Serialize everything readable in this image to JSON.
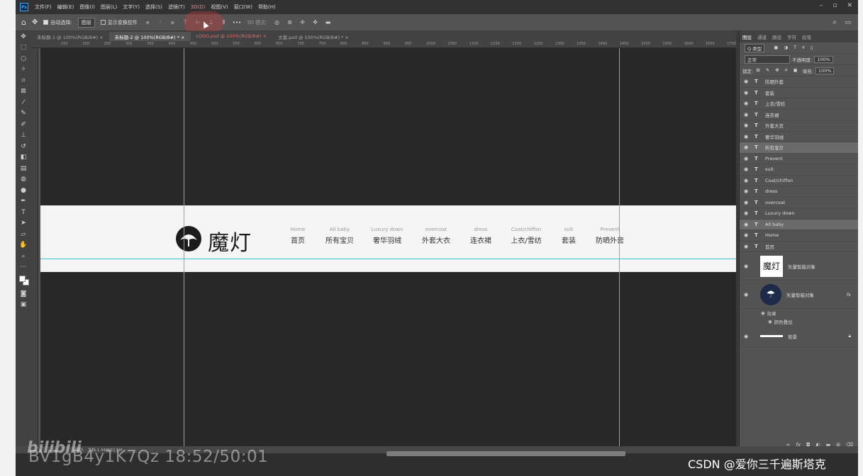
{
  "menubar": {
    "logo": "Ps",
    "items": [
      "文件(F)",
      "编辑(E)",
      "图像(I)",
      "图层(L)",
      "文字(Y)",
      "选择(S)",
      "滤镜(T)",
      "3D(D)",
      "视图(V)",
      "窗口(W)",
      "帮助(H)"
    ],
    "window_controls": [
      "–",
      "▫",
      "✕"
    ]
  },
  "options": {
    "auto_select_label": "自动选择:",
    "auto_select_value": "图层",
    "show_transform_label": "显示变换控件",
    "more": "•••",
    "mode_3d": "3D 模式:"
  },
  "tabs": [
    {
      "label": "未标题-1 @ 100%(RGB/8#)",
      "close": "×"
    },
    {
      "label": "未标题-2 @ 100%(RGB/8#) *",
      "close": "×"
    },
    {
      "label": "LOGO.psd @ 100%(RGB/8#)",
      "close": "×"
    },
    {
      "label": "文案.psd @ 100%(RGB/8#) *",
      "close": "×"
    }
  ],
  "ruler_ticks": [
    "150",
    "200",
    "250",
    "300",
    "350",
    "400",
    "450",
    "500",
    "550",
    "600",
    "650",
    "700",
    "750",
    "800",
    "850",
    "900",
    "950",
    "1000",
    "1050",
    "1100",
    "1150",
    "1200",
    "1250",
    "1300",
    "1350",
    "1400",
    "1450",
    "1500",
    "1550",
    "1600",
    "1650",
    "1700"
  ],
  "banner": {
    "logo_text": "魔灯",
    "nav": [
      {
        "en": "Home",
        "cn": "首页"
      },
      {
        "en": "All baby",
        "cn": "所有宝贝"
      },
      {
        "en": "Luxury down",
        "cn": "奢华羽绒"
      },
      {
        "en": "overcoat",
        "cn": "外套大衣"
      },
      {
        "en": "dress",
        "cn": "连衣裙"
      },
      {
        "en": "Coat/chiffon",
        "cn": "上衣/雪纺"
      },
      {
        "en": "suit",
        "cn": "套装"
      },
      {
        "en": "Prevent",
        "cn": "防晒外套"
      }
    ]
  },
  "panel": {
    "tabs": [
      "图层",
      "通道",
      "路径",
      "字符",
      "段落"
    ],
    "filter_label": "Q 类型",
    "blend_mode": "正常",
    "opacity_label": "不透明度:",
    "opacity_value": "100%",
    "lock_label": "锁定:",
    "fill_label": "填充:",
    "fill_value": "100%",
    "text_layers": [
      "防晒外套",
      "套装",
      "上衣/雪纺",
      "连衣裙",
      "外套大衣",
      "奢华羽绒",
      "所有宝贝",
      "Prevent",
      "suit",
      "Coat/chiffon",
      "dress",
      "overcoat",
      "Luxury down",
      "All baby",
      "Home",
      "首页"
    ],
    "selected_layers": [
      "所有宝贝",
      "All baby"
    ],
    "smart_object_1": "矢量智能对象",
    "smart_object_2": "矢量智能对象",
    "fx": "fx",
    "effects_label": "效果",
    "color_overlay_label": "颜色叠加",
    "background_label": "背景",
    "footer_icons": [
      "link-icon",
      "fx-icon",
      "mask-icon",
      "adjustment-icon",
      "folder-icon",
      "new-layer-icon",
      "trash-icon"
    ]
  },
  "status": {
    "zoom": "100%",
    "doc": "文档:1.34M/22.5M"
  },
  "overlay": {
    "watermark_brand": "bilibili",
    "video_id": "BV1gB4y1K7Qz 18:52/50:01",
    "csdn": "CSDN @爱你三千遍斯塔克"
  }
}
